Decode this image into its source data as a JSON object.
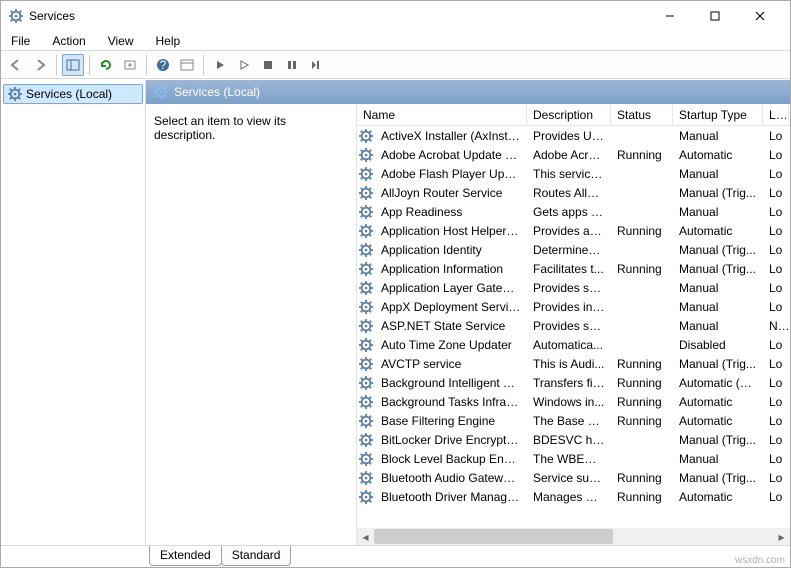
{
  "window": {
    "title": "Services"
  },
  "menu": {
    "file": "File",
    "action": "Action",
    "view": "View",
    "help": "Help"
  },
  "tree": {
    "root": "Services (Local)"
  },
  "header": {
    "title": "Services (Local)"
  },
  "desc": {
    "hint": "Select an item to view its description."
  },
  "columns": {
    "name": "Name",
    "description": "Description",
    "status": "Status",
    "startup": "Startup Type",
    "logon": "Lo"
  },
  "tabs": {
    "extended": "Extended",
    "standard": "Standard"
  },
  "watermark": "wsxdn.com",
  "services": [
    {
      "name": "ActiveX Installer (AxInstSV)",
      "desc": "Provides Us...",
      "status": "",
      "startup": "Manual",
      "logon": "Lo"
    },
    {
      "name": "Adobe Acrobat Update Serv...",
      "desc": "Adobe Acro...",
      "status": "Running",
      "startup": "Automatic",
      "logon": "Lo"
    },
    {
      "name": "Adobe Flash Player Update ...",
      "desc": "This service ...",
      "status": "",
      "startup": "Manual",
      "logon": "Lo"
    },
    {
      "name": "AllJoyn Router Service",
      "desc": "Routes AllJo...",
      "status": "",
      "startup": "Manual (Trig...",
      "logon": "Lo"
    },
    {
      "name": "App Readiness",
      "desc": "Gets apps re...",
      "status": "",
      "startup": "Manual",
      "logon": "Lo"
    },
    {
      "name": "Application Host Helper Ser...",
      "desc": "Provides ad...",
      "status": "Running",
      "startup": "Automatic",
      "logon": "Lo"
    },
    {
      "name": "Application Identity",
      "desc": "Determines ...",
      "status": "",
      "startup": "Manual (Trig...",
      "logon": "Lo"
    },
    {
      "name": "Application Information",
      "desc": "Facilitates t...",
      "status": "Running",
      "startup": "Manual (Trig...",
      "logon": "Lo"
    },
    {
      "name": "Application Layer Gateway ...",
      "desc": "Provides su...",
      "status": "",
      "startup": "Manual",
      "logon": "Lo"
    },
    {
      "name": "AppX Deployment Service (...",
      "desc": "Provides inf...",
      "status": "",
      "startup": "Manual",
      "logon": "Lo"
    },
    {
      "name": "ASP.NET State Service",
      "desc": "Provides su...",
      "status": "",
      "startup": "Manual",
      "logon": "Ne"
    },
    {
      "name": "Auto Time Zone Updater",
      "desc": "Automatica...",
      "status": "",
      "startup": "Disabled",
      "logon": "Lo"
    },
    {
      "name": "AVCTP service",
      "desc": "This is Audi...",
      "status": "Running",
      "startup": "Manual (Trig...",
      "logon": "Lo"
    },
    {
      "name": "Background Intelligent Tran...",
      "desc": "Transfers fil...",
      "status": "Running",
      "startup": "Automatic (D...",
      "logon": "Lo"
    },
    {
      "name": "Background Tasks Infrastru...",
      "desc": "Windows in...",
      "status": "Running",
      "startup": "Automatic",
      "logon": "Lo"
    },
    {
      "name": "Base Filtering Engine",
      "desc": "The Base Fil...",
      "status": "Running",
      "startup": "Automatic",
      "logon": "Lo"
    },
    {
      "name": "BitLocker Drive Encryption ...",
      "desc": "BDESVC hos...",
      "status": "",
      "startup": "Manual (Trig...",
      "logon": "Lo"
    },
    {
      "name": "Block Level Backup Engine ...",
      "desc": "The WBENG...",
      "status": "",
      "startup": "Manual",
      "logon": "Lo"
    },
    {
      "name": "Bluetooth Audio Gateway S...",
      "desc": "Service sup...",
      "status": "Running",
      "startup": "Manual (Trig...",
      "logon": "Lo"
    },
    {
      "name": "Bluetooth Driver Managem...",
      "desc": "Manages BT...",
      "status": "Running",
      "startup": "Automatic",
      "logon": "Lo"
    }
  ]
}
